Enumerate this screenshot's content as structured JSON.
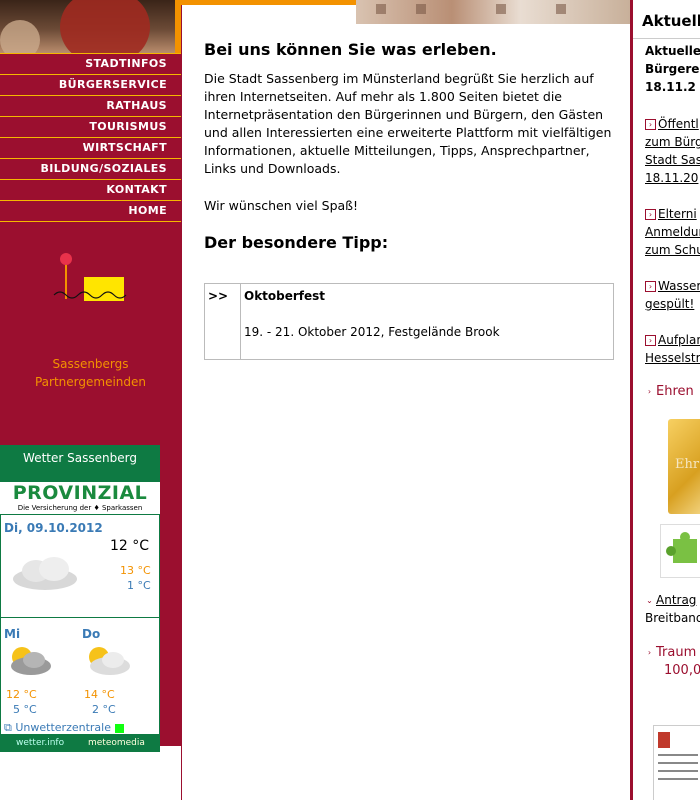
{
  "nav": {
    "items": [
      "STADTINFOS",
      "BÜRGERSERVICE",
      "RATHAUS",
      "TOURISMUS",
      "WIRTSCHAFT",
      "BILDUNG/SOZIALES",
      "KONTAKT",
      "HOME"
    ]
  },
  "partner": {
    "line1": "Sassenbergs",
    "line2": "Partnergemeinden"
  },
  "weather": {
    "header": "Wetter Sassenberg",
    "sponsor": "PROVINZIAL",
    "sponsor_tag": "Die Versicherung der ♦ Sparkassen",
    "today_label": "Di, 09.10.2012",
    "temp_now": "12 °C",
    "temp_hi": "13 °C",
    "temp_lo": "1 °C",
    "day1": {
      "label": "Mi",
      "hi": "12 °C",
      "lo": "5 °C"
    },
    "day2": {
      "label": "Do",
      "hi": "14 °C",
      "lo": "2 °C"
    },
    "warn_link": "Unwetterzentrale",
    "footer_left": "wetter.info",
    "footer_right": "meteomedia",
    "colors": {
      "green": "#0e7a43",
      "orange": "#f39200",
      "blue": "#3a7ab5"
    }
  },
  "main": {
    "heading": "Bei uns können Sie was erleben.",
    "intro": "Die Stadt Sassenberg im Münsterland begrüßt Sie herzlich auf ihren Internetseiten. Auf mehr als 1.800 Seiten bietet die Internetpräsentation den Bürgerinnen und Bürgern, den Gästen und allen Interessierten eine erweiterte Plattform mit vielfältigen Informationen, aktuelle Mitteilungen, Tipps, Ansprechpartner, Links und Downloads.",
    "wish": "Wir wünschen viel Spaß!",
    "tipp_heading": "Der besondere Tipp:",
    "tipp": {
      "arrow": ">>",
      "title": "Oktoberfest",
      "desc": "19. - 21. Oktober 2012, Festgelände Brook"
    }
  },
  "right": {
    "title": "Aktuell",
    "bold_lines": [
      "Aktuelle",
      "Bürgere",
      "18.11.2"
    ],
    "link1": [
      "Öffentl",
      "zum Bürg",
      "Stadt Sas",
      "18.11.20"
    ],
    "link2": [
      "Elterni",
      "Anmeldun",
      "zum Schu"
    ],
    "link3": [
      "Wasser",
      "gespült!"
    ],
    "link4": [
      "Aufplan",
      "Hesselstr"
    ],
    "ehren": "Ehren",
    "gold_text": "Ehr",
    "link5": [
      "Antrag",
      "Breitband"
    ],
    "traum": [
      "Traum",
      "100,0"
    ]
  },
  "colors": {
    "brand": "#9b0f2f",
    "accent": "#f39200",
    "nav_border": "#f5b800"
  }
}
